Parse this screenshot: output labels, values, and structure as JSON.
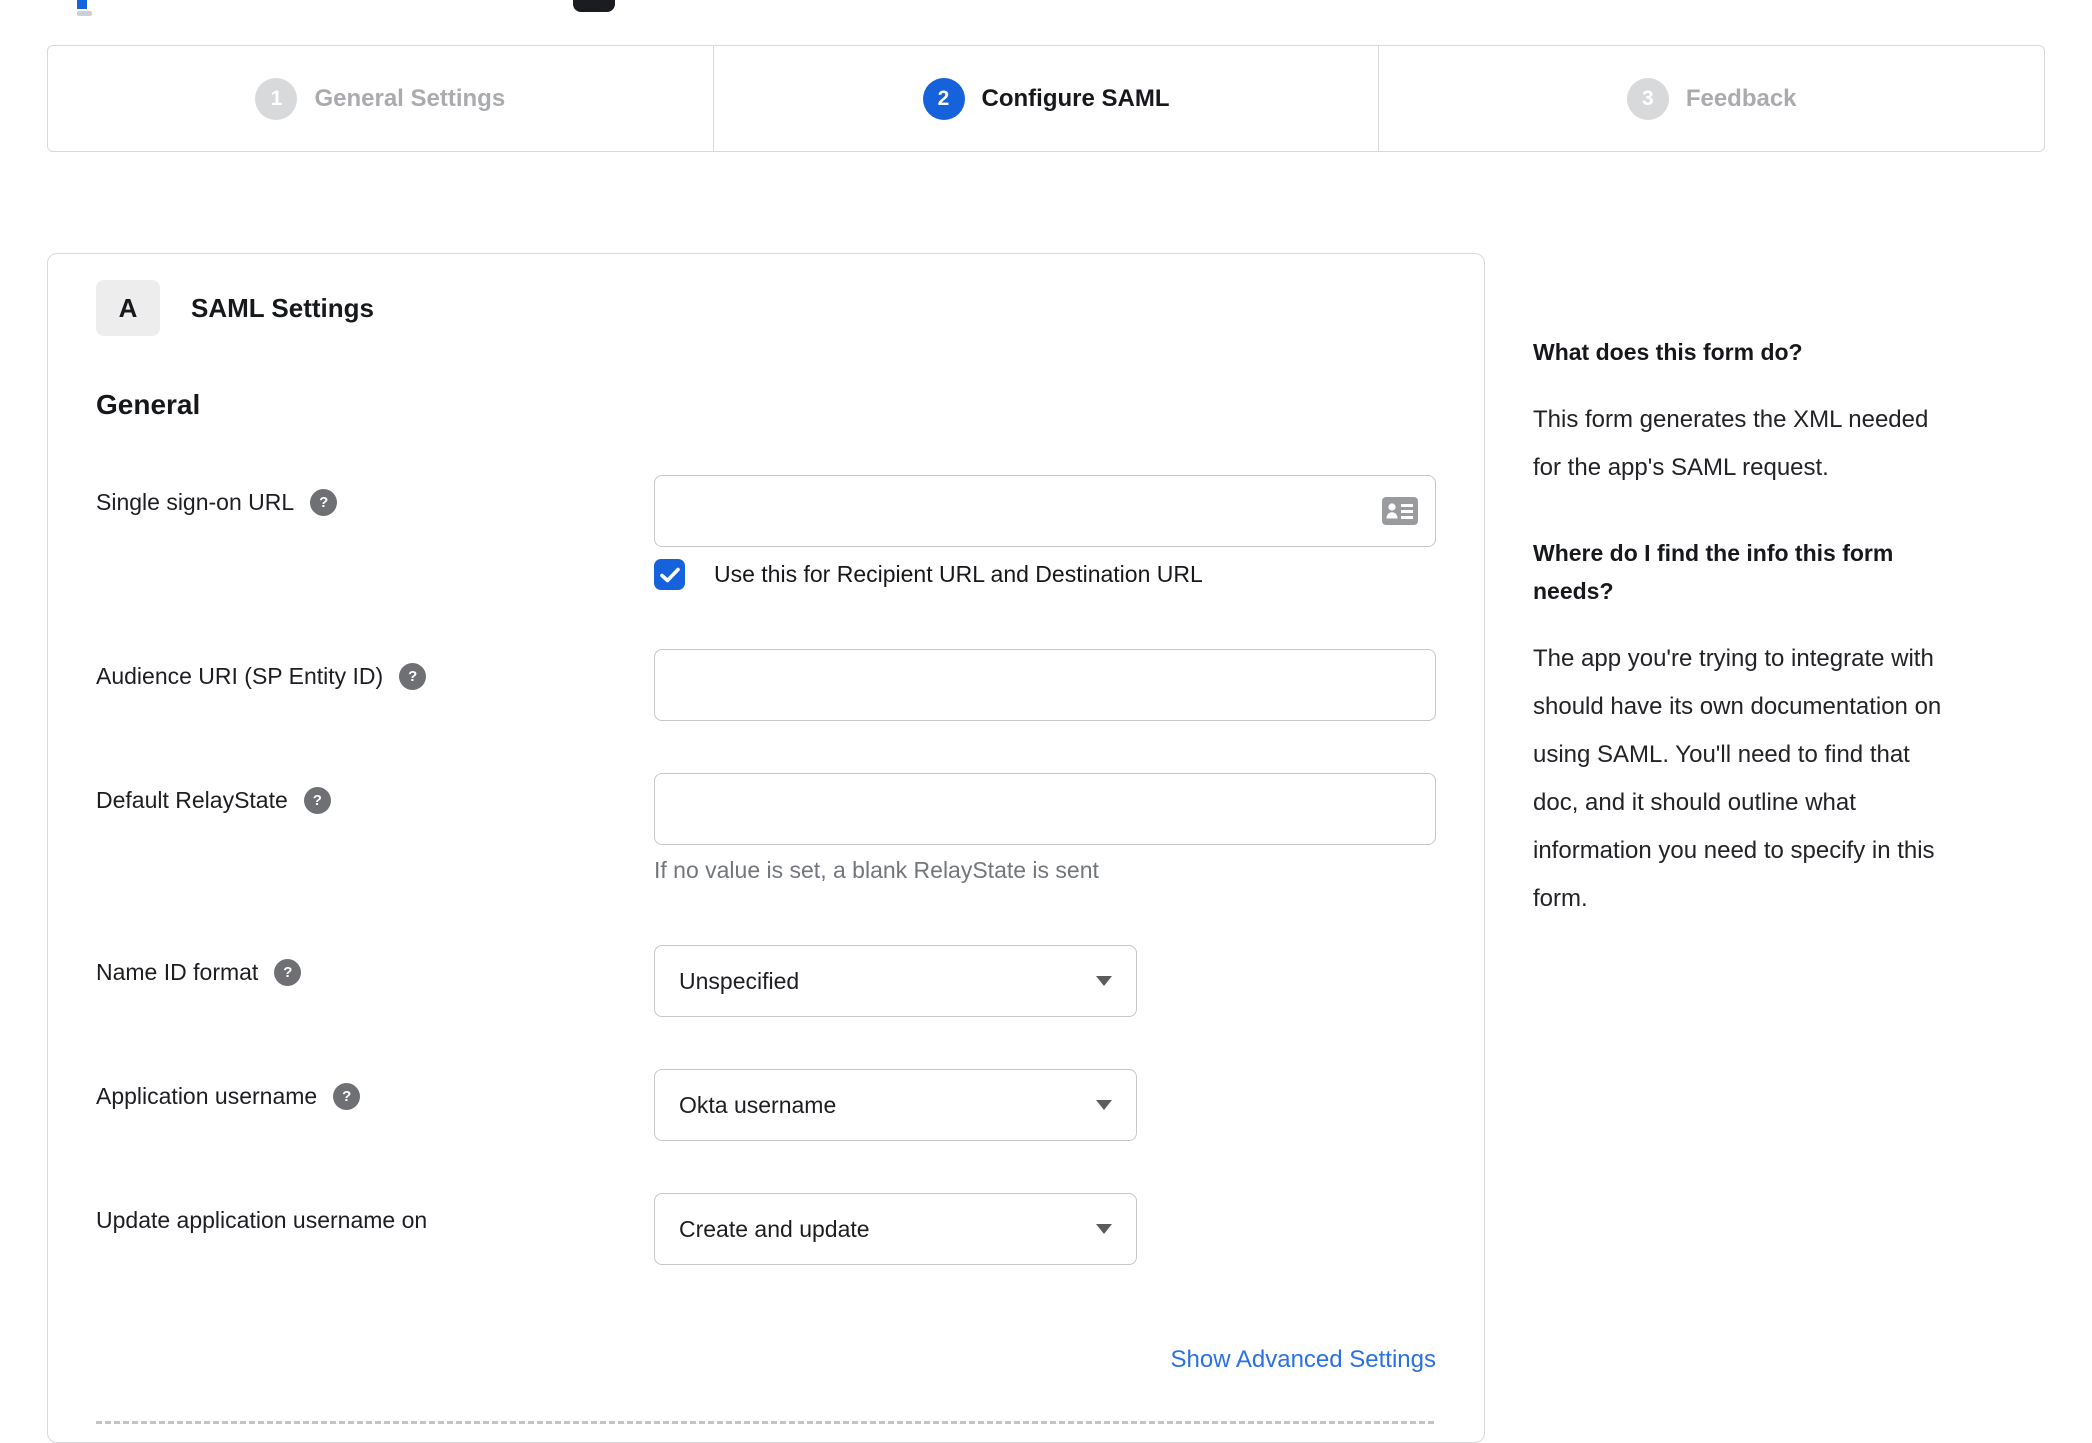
{
  "colors": {
    "primary_blue": "#1662dd",
    "link_blue": "#2970e6",
    "inactive_step_gray": "#a9abae",
    "input_border_gray": "#c7c7ca",
    "hint_gray": "#73767b"
  },
  "stepper": {
    "steps": [
      {
        "number": "1",
        "label": "General Settings",
        "state": "inactive"
      },
      {
        "number": "2",
        "label": "Configure SAML",
        "state": "active"
      },
      {
        "number": "3",
        "label": "Feedback",
        "state": "inactive"
      }
    ]
  },
  "saml_panel": {
    "badge": "A",
    "title": "SAML Settings",
    "section_heading": "General",
    "sso": {
      "label": "Single sign-on URL",
      "value": "",
      "input_icon": "address-card-icon",
      "checkbox_checked": true,
      "checkbox_label": "Use this for Recipient URL and Destination URL"
    },
    "audience": {
      "label": "Audience URI (SP Entity ID)",
      "value": ""
    },
    "relay_state": {
      "label": "Default RelayState",
      "value": "",
      "hint": "If no value is set, a blank RelayState is sent"
    },
    "name_id_format": {
      "label": "Name ID format",
      "value": "Unspecified"
    },
    "application_username": {
      "label": "Application username",
      "value": "Okta username"
    },
    "update_app_username": {
      "label": "Update application username on",
      "value": "Create and update"
    },
    "advanced_link": "Show Advanced Settings"
  },
  "help_panel": {
    "heading_1": "What does this form do?",
    "body_1": "This form generates the XML needed\nfor the app's SAML request.",
    "heading_2": "Where do I find the info this form\nneeds?",
    "body_2": "The app you're trying to integrate with\nshould have its own documentation on\nusing SAML. You'll need to find that\ndoc, and it should outline what\ninformation you need to specify in this\nform."
  }
}
